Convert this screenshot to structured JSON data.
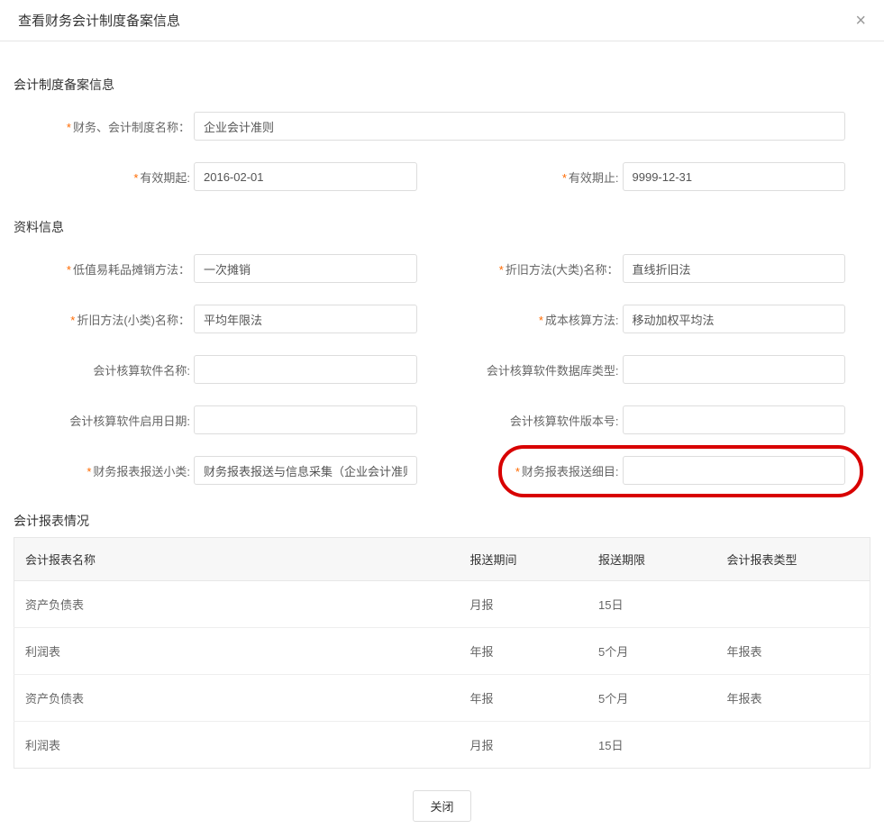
{
  "header": {
    "title": "查看财务会计制度备案信息"
  },
  "sections": {
    "filing": {
      "title": "会计制度备案信息",
      "system_name": {
        "label": "财务、会计制度名称：",
        "value": "企业会计准则",
        "required": true
      },
      "valid_from": {
        "label": "有效期起:",
        "value": "2016-02-01",
        "required": true
      },
      "valid_to": {
        "label": "有效期止:",
        "value": "9999-12-31",
        "required": true
      }
    },
    "data": {
      "title": "资料信息",
      "low_value_amort": {
        "label": "低值易耗品摊销方法：",
        "value": "一次摊销",
        "required": true
      },
      "depr_major": {
        "label": "折旧方法(大类)名称：",
        "value": "直线折旧法",
        "required": true
      },
      "depr_minor": {
        "label": "折旧方法(小类)名称：",
        "value": "平均年限法",
        "required": true
      },
      "cost_method": {
        "label": "成本核算方法:",
        "value": "移动加权平均法",
        "required": true
      },
      "sw_name": {
        "label": "会计核算软件名称:",
        "value": "",
        "required": false
      },
      "sw_db_type": {
        "label": "会计核算软件数据库类型:",
        "value": "",
        "required": false
      },
      "sw_enable_date": {
        "label": "会计核算软件启用日期:",
        "value": "",
        "required": false
      },
      "sw_version": {
        "label": "会计核算软件版本号:",
        "value": "",
        "required": false
      },
      "report_sub": {
        "label": "财务报表报送小类:",
        "value": "财务报表报送与信息采集（企业会计准则一般企",
        "required": true
      },
      "report_detail": {
        "label": "财务报表报送细目:",
        "value": "",
        "required": true
      }
    },
    "report": {
      "title": "会计报表情况",
      "headers": {
        "name": "会计报表名称",
        "period": "报送期间",
        "deadline": "报送期限",
        "type": "会计报表类型"
      },
      "rows": [
        {
          "name": "资产负债表",
          "period": "月报",
          "deadline": "15日",
          "type": ""
        },
        {
          "name": "利润表",
          "period": "年报",
          "deadline": "5个月",
          "type": "年报表"
        },
        {
          "name": "资产负债表",
          "period": "年报",
          "deadline": "5个月",
          "type": "年报表"
        },
        {
          "name": "利润表",
          "period": "月报",
          "deadline": "15日",
          "type": ""
        }
      ]
    }
  },
  "footer": {
    "close": "关闭"
  }
}
